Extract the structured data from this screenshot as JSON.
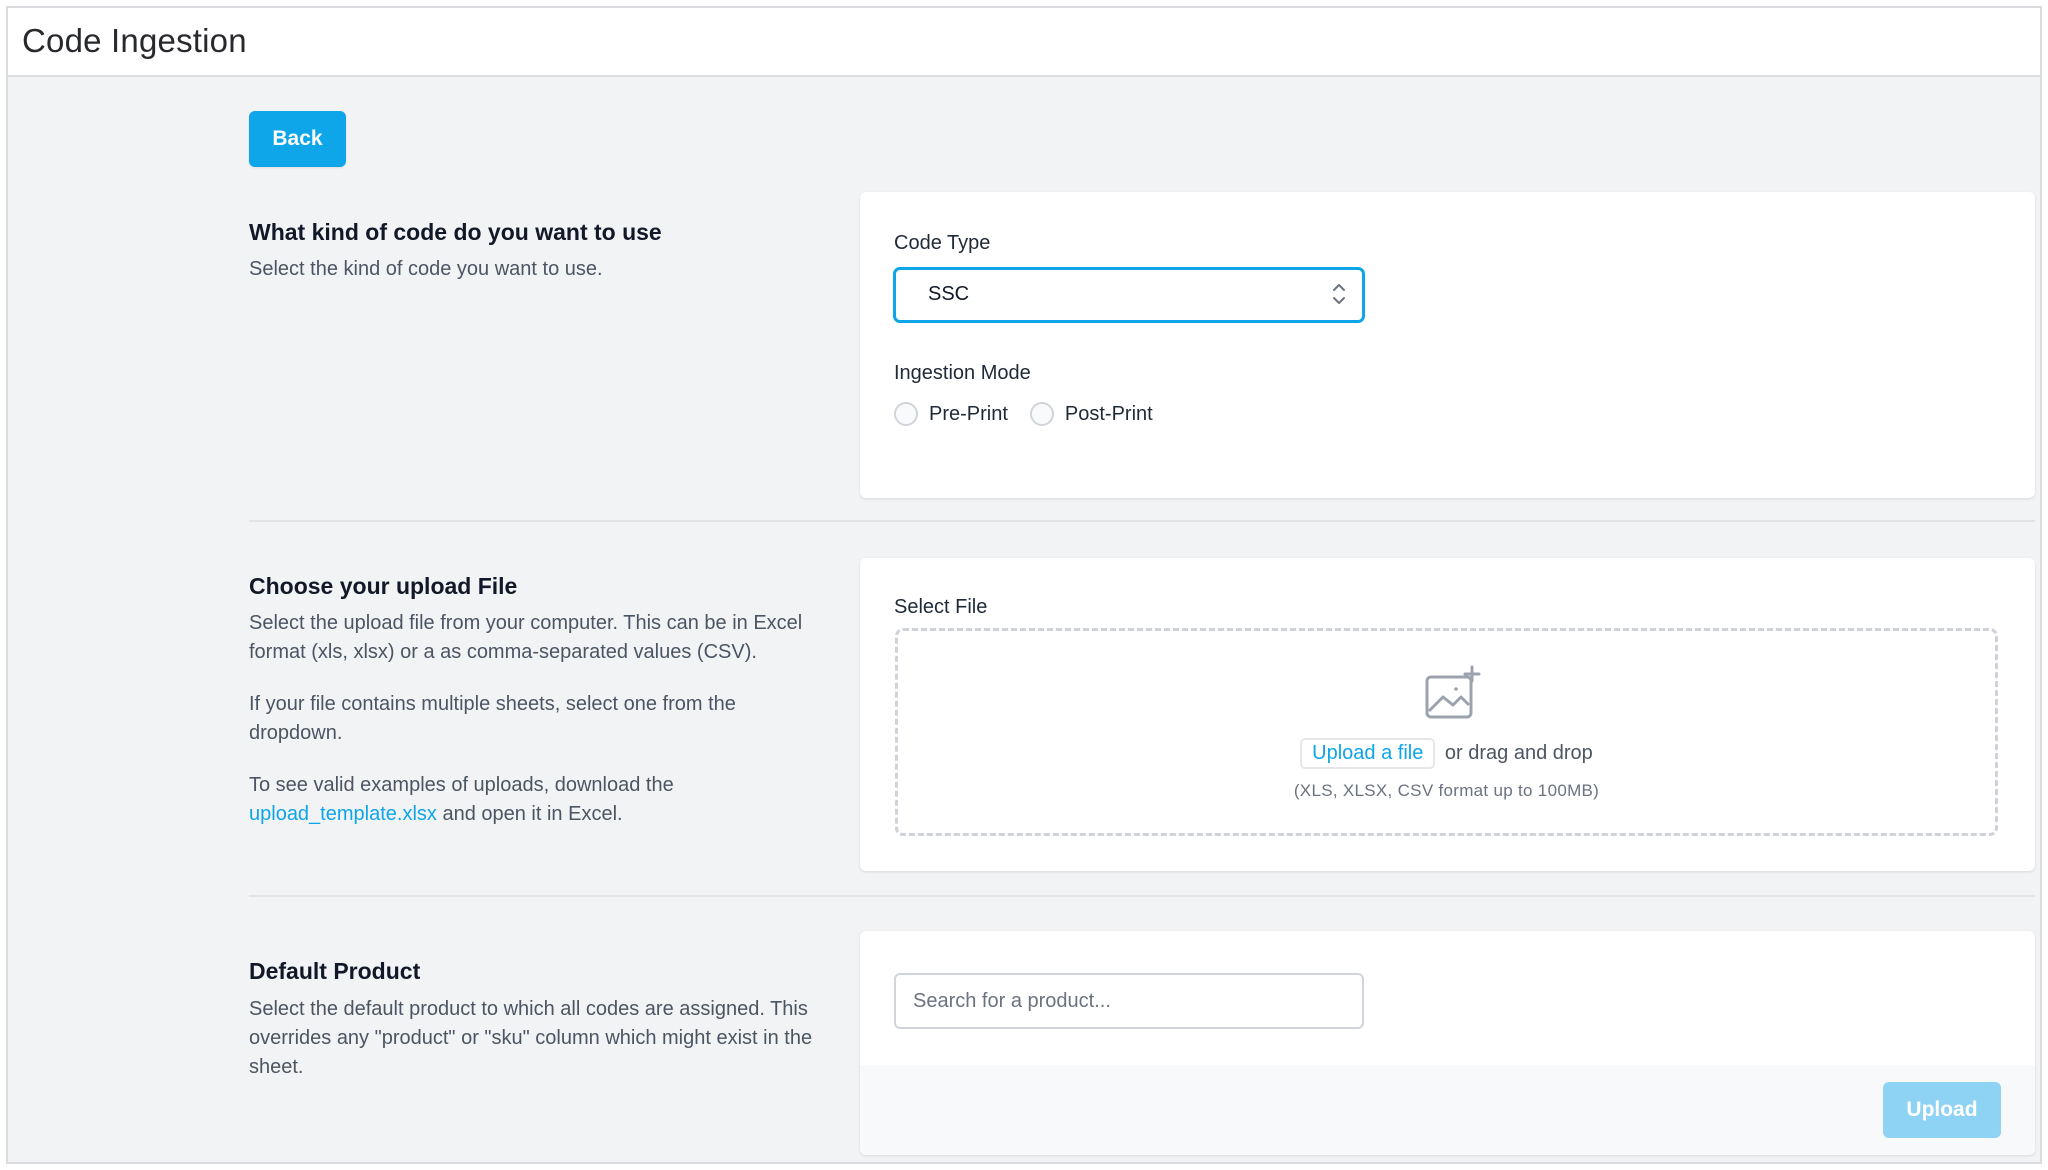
{
  "window": {
    "title": "Code Ingestion"
  },
  "actions": {
    "back_label": "Back"
  },
  "code_section": {
    "title": "What kind of code do you want to use",
    "description": "Select the kind of code you want to use.",
    "code_type_label": "Code Type",
    "code_type_value": "SSC",
    "ingestion_mode_label": "Ingestion Mode",
    "modes": [
      "Pre-Print",
      "Post-Print"
    ],
    "selected_mode": null
  },
  "upload_section": {
    "title": "Choose your upload File",
    "description_1": "Select the upload file from your computer. This can be in Excel format (xls, xlsx) or a as comma-separated values (CSV).",
    "description_2": "If your file contains multiple sheets, select one from the dropdown.",
    "description_3_prefix": "To see valid examples of uploads, download the",
    "template_link": "upload_template.xlsx",
    "description_3_suffix": "and open it in Excel.",
    "select_file_label": "Select File",
    "upload_link": "Upload a file",
    "drag_text": "or drag and drop",
    "format_hint": "(XLS, XLSX, CSV format up to 100MB)",
    "icon": "image-plus-icon"
  },
  "product_section": {
    "title": "Default Product",
    "description": "Select the default product to which all codes are assigned. This overrides any \"product\" or \"sku\" column which might exist in the sheet.",
    "search_placeholder": "Search for a product...",
    "search_value": "",
    "upload_label": "Upload",
    "upload_enabled": false
  },
  "colors": {
    "accent": "#0ea5e9",
    "accent_disabled": "#8fd3f4",
    "background": "#f2f3f5"
  }
}
